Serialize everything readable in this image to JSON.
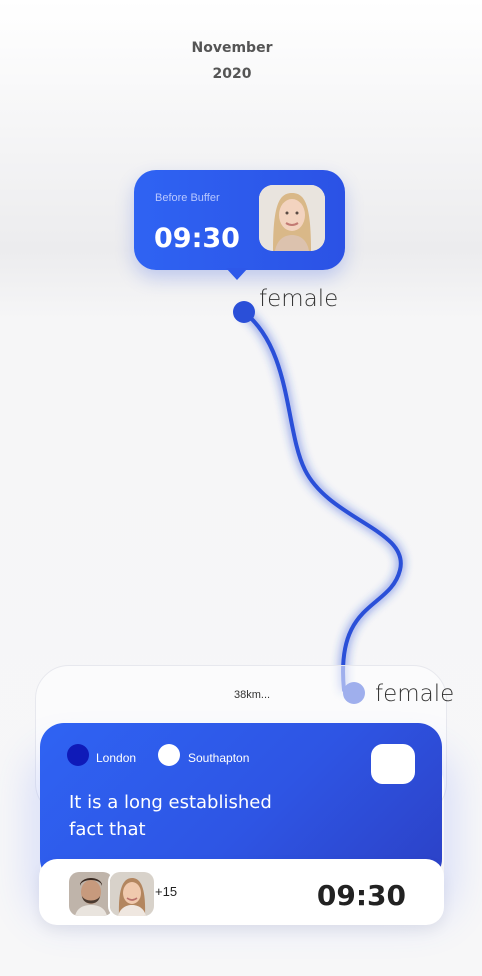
{
  "header": {
    "month": "November",
    "year": "2020"
  },
  "bubble": {
    "label": "Before Buffer",
    "time": "09:30"
  },
  "markers": {
    "start_label": "female",
    "end_label": "female"
  },
  "trip": {
    "distance": "38km...",
    "origin": "London",
    "destination": "Southapton",
    "message": "It is a long established fact that",
    "extra_count": "+15",
    "time": "09:30"
  },
  "colors": {
    "primary": "#2f63f3",
    "route": "#2a4fd8",
    "origin_dot": "#0f1ab8"
  },
  "icons": {
    "avatar_top": "woman-portrait",
    "avatar_a": "man-portrait",
    "avatar_b": "woman-portrait"
  }
}
